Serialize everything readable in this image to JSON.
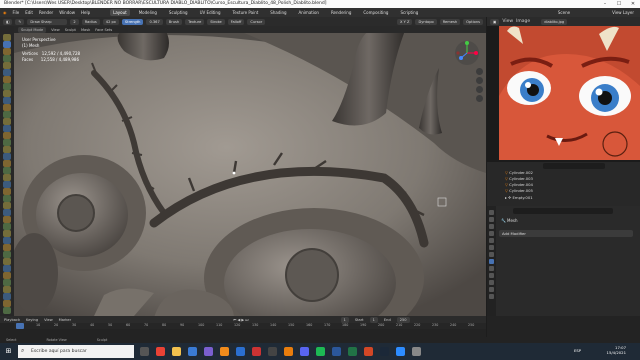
{
  "window": {
    "title": "Blender* [C:\\Users\\Wes USER\\Desktop\\BLENDER NO BORRAR\\ESCULTURA DIABLO_DIABLITO\\Curso_Escultura_Diablito_48_Polish_Diablito.blend]"
  },
  "menus": [
    "File",
    "Edit",
    "Render",
    "Window",
    "Help"
  ],
  "workspaces": [
    "Layout",
    "Modeling",
    "Sculpting",
    "UV Editing",
    "Texture Paint",
    "Shading",
    "Animation",
    "Rendering",
    "Compositing",
    "Scripting"
  ],
  "active_workspace": "Layout",
  "scene": {
    "label": "Scene",
    "view_layer": "View Layer"
  },
  "header3d": {
    "brush": "Draw Sharp",
    "radius_label": "Radius",
    "radius_value": "42 px",
    "strength_label": "Strength",
    "strength_value": "0.367",
    "brush_menu": "Brush",
    "texture_menu": "Texture",
    "stroke_menu": "Stroke",
    "falloff_menu": "Falloff",
    "cursor_menu": "Cursor",
    "symmetry": "Dyntopo",
    "remesh": "Remesh",
    "options": "Options"
  },
  "subheader": {
    "mode": "Sculpt Mode",
    "items": [
      "View",
      "Sculpt",
      "Mask",
      "Face Sets"
    ]
  },
  "overlay": {
    "view": "User Perspective",
    "object": "(1) Mesh",
    "vertices_label": "Vertices",
    "vertices_value": "12,592 / 4,490,728",
    "faces_label": "Faces",
    "faces_value": "12,558 / 4,489,986"
  },
  "image_editor": {
    "view": "View",
    "image": "Image",
    "filename": "diablito.jpg"
  },
  "outliner": {
    "search_placeholder": "",
    "rows": [
      {
        "name": "Cylinder.002"
      },
      {
        "name": "Cylinder.003"
      },
      {
        "name": "Cylinder.004"
      },
      {
        "name": "Cylinder.005"
      },
      {
        "name": "Empty.001"
      }
    ]
  },
  "properties": {
    "object": "Mesh",
    "add_modifier": "Add Modifier"
  },
  "timeline": {
    "menus": [
      "Playback",
      "Keying",
      "View",
      "Marker"
    ],
    "current_frame": "1",
    "start_label": "Start",
    "start_value": "1",
    "end_label": "End",
    "end_value": "250",
    "ticks": [
      "0",
      "10",
      "20",
      "30",
      "40",
      "50",
      "60",
      "70",
      "80",
      "90",
      "100",
      "110",
      "120",
      "130",
      "140",
      "150",
      "160",
      "170",
      "180",
      "190",
      "200",
      "210",
      "220",
      "230",
      "240",
      "250"
    ]
  },
  "statusbar": {
    "select": "Select",
    "rotate": "Rotate View",
    "sculpt": "Sculpt"
  },
  "taskbar": {
    "search_placeholder": "Escribe aquí para buscar",
    "time": "17:07",
    "date": "15/4/2021",
    "lang": "ESP"
  }
}
